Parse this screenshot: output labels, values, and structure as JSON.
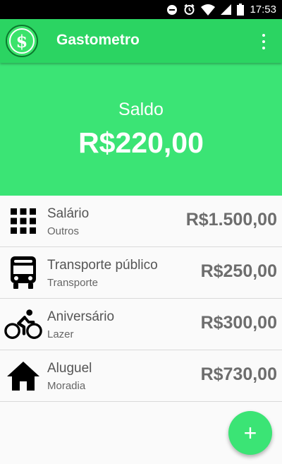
{
  "status_bar": {
    "time": "17:53",
    "icons": [
      "dnd-icon",
      "alarm-icon",
      "wifi-icon",
      "signal-icon",
      "battery-icon"
    ]
  },
  "app_bar": {
    "title": "Gastometro",
    "logo_icon": "dollar-icon",
    "menu_icon": "more-vert-icon"
  },
  "balance": {
    "label": "Saldo",
    "value": "R$220,00"
  },
  "transactions": [
    {
      "title": "Salário",
      "category": "Outros",
      "amount": "R$1.500,00",
      "icon": "apps-grid-icon"
    },
    {
      "title": "Transporte público",
      "category": "Transporte",
      "amount": "R$250,00",
      "icon": "bus-icon"
    },
    {
      "title": "Aniversário",
      "category": "Lazer",
      "amount": "R$300,00",
      "icon": "bike-icon"
    },
    {
      "title": "Aluguel",
      "category": "Moradia",
      "amount": "R$730,00",
      "icon": "home-icon"
    }
  ],
  "fab": {
    "label": "+",
    "icon": "add-icon"
  },
  "colors": {
    "primary": "#2bd462",
    "accent": "#3be475",
    "text_secondary": "#6d6d6d"
  }
}
